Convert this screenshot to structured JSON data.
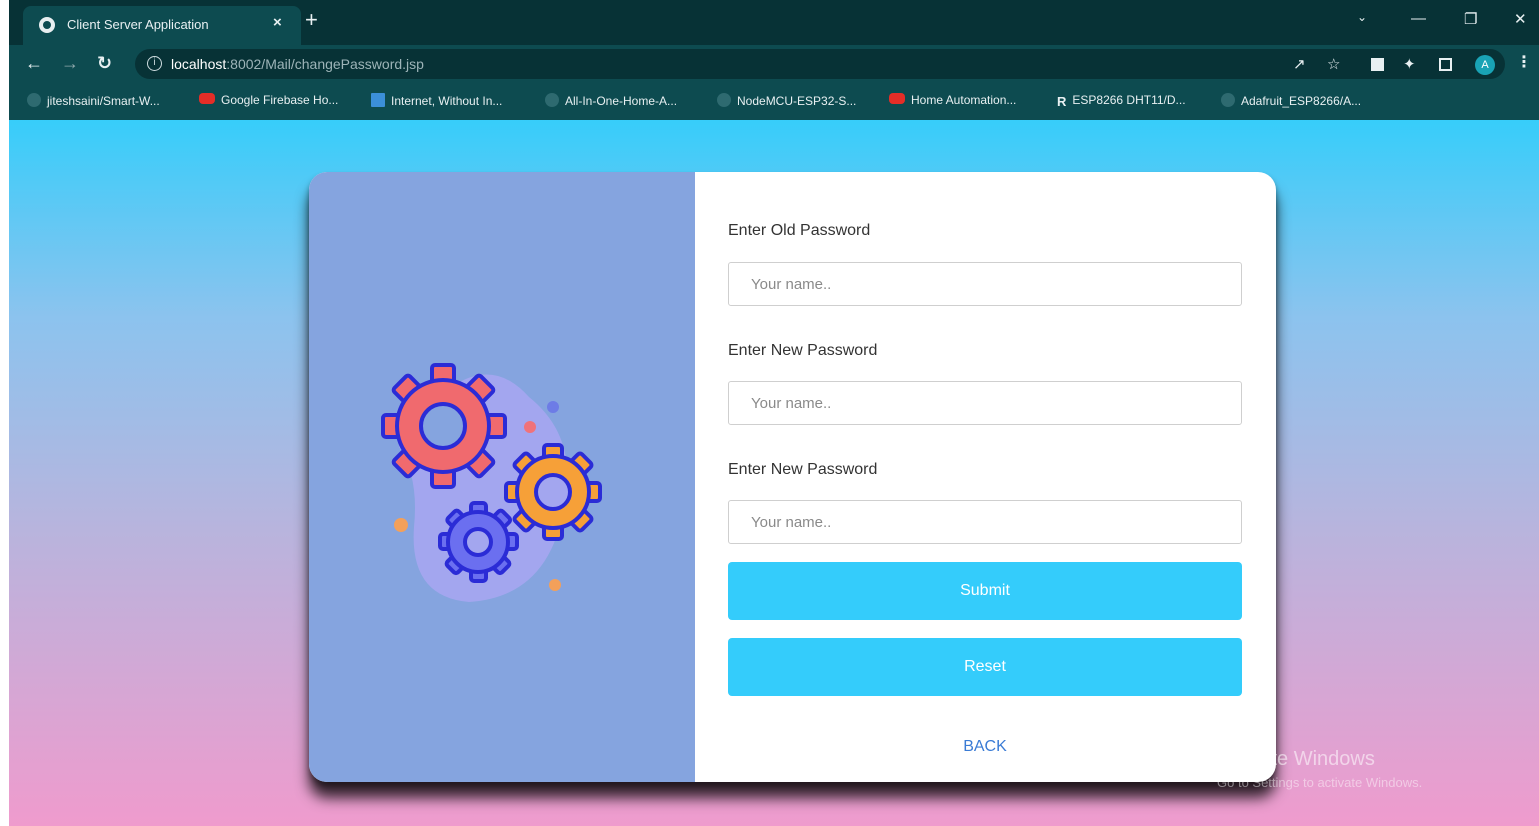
{
  "browser": {
    "tab_title": "Client Server Application",
    "tab_close": "×",
    "new_tab": "+",
    "url_host": "localhost",
    "url_rest": ":8002/Mail/changePassword.jsp",
    "profile_initial": "A",
    "bookmarks": [
      {
        "label": "jiteshsaini/Smart-W...",
        "icon": "github-icon"
      },
      {
        "label": "Google Firebase Ho...",
        "icon": "youtube-icon"
      },
      {
        "label": "Internet, Without In...",
        "icon": "page-icon"
      },
      {
        "label": "All-In-One-Home-A...",
        "icon": "github-icon"
      },
      {
        "label": "NodeMCU-ESP32-S...",
        "icon": "github-icon"
      },
      {
        "label": "Home Automation...",
        "icon": "youtube-icon"
      },
      {
        "label": "ESP8266 DHT11/D...",
        "icon": "r-icon",
        "icon_text": "R"
      },
      {
        "label": "Adafruit_ESP8266/A...",
        "icon": "github-icon"
      }
    ]
  },
  "form": {
    "old_password_label": "Enter Old Password",
    "old_password_placeholder": "Your name..",
    "new_password_label": "Enter New Password",
    "new_password_placeholder": "Your name..",
    "confirm_password_label": "Enter New Password",
    "confirm_password_placeholder": "Your name..",
    "submit_label": "Submit",
    "reset_label": "Reset",
    "back_label": "BACK"
  },
  "watermark": {
    "title": "Activate Windows",
    "subtitle": "Go to Settings to activate Windows."
  },
  "colors": {
    "accent": "#34ccfb",
    "left_panel": "#85a4df",
    "link": "#3a7bd5"
  }
}
